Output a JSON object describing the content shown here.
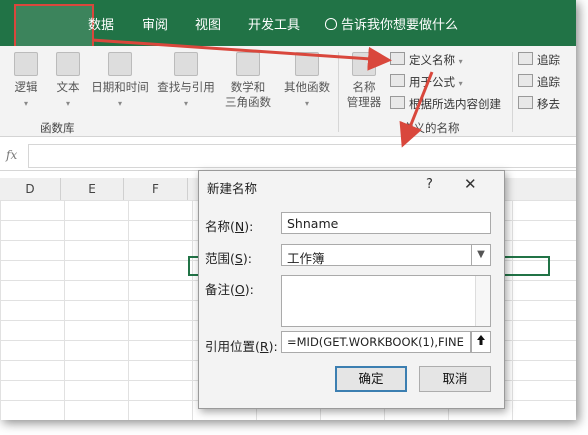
{
  "colors": {
    "ribbon_green": "#217346",
    "annotation_red": "#d9473c",
    "dialog_bg": "#f3f3f3"
  },
  "ribbon_tabs": [
    "数据",
    "审阅",
    "视图",
    "开发工具"
  ],
  "tell_me": "告诉我你想要做什么",
  "function_library": {
    "buttons": [
      {
        "label": "逻辑",
        "icon": "logic-icon"
      },
      {
        "label": "文本",
        "icon": "text-icon"
      },
      {
        "label": "日期和时间",
        "icon": "calendar-icon"
      },
      {
        "label": "查找与引用",
        "icon": "lookup-icon"
      },
      {
        "label": "数学和",
        "label2": "三角函数",
        "icon": "math-icon"
      },
      {
        "label": "其他函数",
        "icon": "more-functions-icon"
      }
    ],
    "group_label": "函数库"
  },
  "defined_names": {
    "name_manager_line1": "名称",
    "name_manager_line2": "管理器",
    "define_name": "定义名称",
    "use_in_formula": "用于公式",
    "create_from_selection": "根据所选内容创建",
    "group_label": "定义的名称"
  },
  "formula_auditing": {
    "trace_precedents": "追踪",
    "trace_dependents": "追踪",
    "remove_arrows": "移去"
  },
  "formula_bar": {
    "fx": "fx"
  },
  "columns": [
    "D",
    "E",
    "F"
  ],
  "dialog": {
    "title": "新建名称",
    "help": "?",
    "close": "✕",
    "name_label": "名称(",
    "name_key": "N",
    "name_suffix": "):",
    "name_value": "Shname",
    "scope_label": "范围(",
    "scope_key": "S",
    "scope_suffix": "):",
    "scope_value": "工作簿",
    "comment_label": "备注(",
    "comment_key": "O",
    "comment_suffix": "):",
    "refers_label": "引用位置(",
    "refers_key": "R",
    "refers_suffix": "):",
    "refers_value": "=MID(GET.WORKBOOK(1),FINE",
    "ok": "确定",
    "cancel": "取消"
  }
}
